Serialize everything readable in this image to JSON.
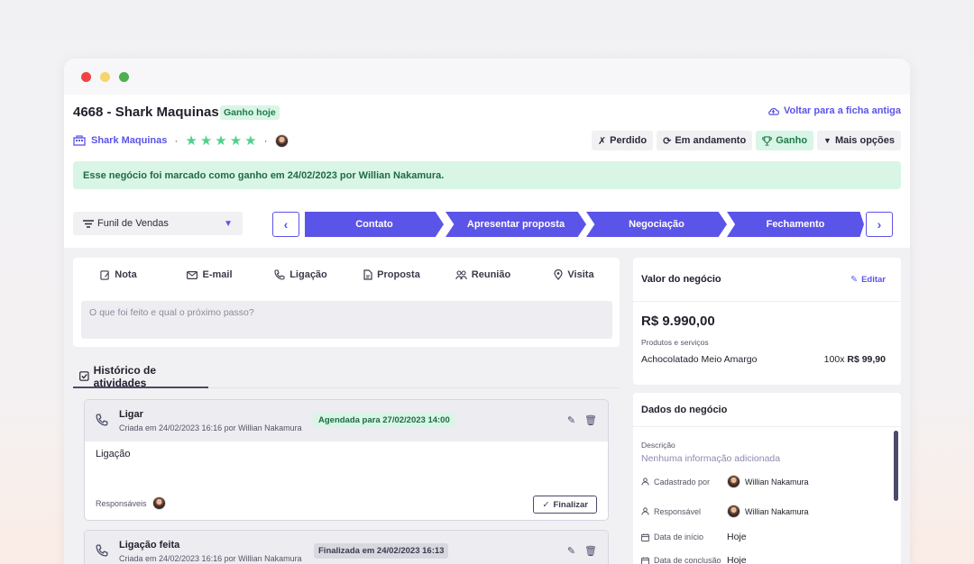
{
  "header": {
    "deal_title": "4668 - Shark Maquinas",
    "status_badge": "Ganho hoje",
    "back_link": "Voltar para a ficha antiga",
    "company_name": "Shark Maquinas",
    "rating": 5,
    "status_buttons": {
      "lost": "Perdido",
      "in_progress": "Em andamento",
      "won": "Ganho",
      "more": "Mais opções"
    },
    "alert": "Esse negócio foi marcado como ganho em 24/02/2023 por Willian Nakamura."
  },
  "pipeline": {
    "funnel": "Funil de Vendas",
    "stages": [
      "Contato",
      "Apresentar proposta",
      "Negociação",
      "Fechamento"
    ]
  },
  "note": {
    "tabs": [
      "Nota",
      "E-mail",
      "Ligação",
      "Proposta",
      "Reunião",
      "Visita"
    ],
    "placeholder": "O que foi feito e qual o próximo passo?"
  },
  "history": {
    "tab_label": "Histórico de atividades",
    "activities": [
      {
        "title": "Ligar",
        "subtitle": "Criada em 24/02/2023 16:16 por Willian Nakamura",
        "badge": "Agendada para 27/02/2023 14:00",
        "body": "Ligação",
        "responsible_label": "Responsáveis",
        "finalize_label": "Finalizar"
      },
      {
        "title": "Ligação feita",
        "subtitle": "Criada em 24/02/2023 16:16 por Willian Nakamura",
        "badge": "Finalizada em 24/02/2023 16:13"
      }
    ]
  },
  "deal_value": {
    "title": "Valor do negócio",
    "edit_label": "Editar",
    "amount": "R$ 9.990,00",
    "products_label": "Produtos e serviços",
    "product_name": "Achocolatado Meio Amargo",
    "product_qty": "100x",
    "product_price": "R$ 99,90"
  },
  "deal_data": {
    "title": "Dados do negócio",
    "description_label": "Descrição",
    "description_value": "Nenhuma informação adicionada",
    "registered_by_label": "Cadastrado por",
    "registered_by": "Willian Nakamura",
    "responsible_label": "Responsável",
    "responsible": "Willian Nakamura",
    "start_date_label": "Data de início",
    "start_date": "Hoje",
    "end_date_label": "Data de conclusão",
    "end_date": "Hoje"
  },
  "colors": {
    "accent": "#5b54e8",
    "success_bg": "#d9f5e6",
    "success_text": "#1f6b43",
    "star": "#4fd18b"
  }
}
